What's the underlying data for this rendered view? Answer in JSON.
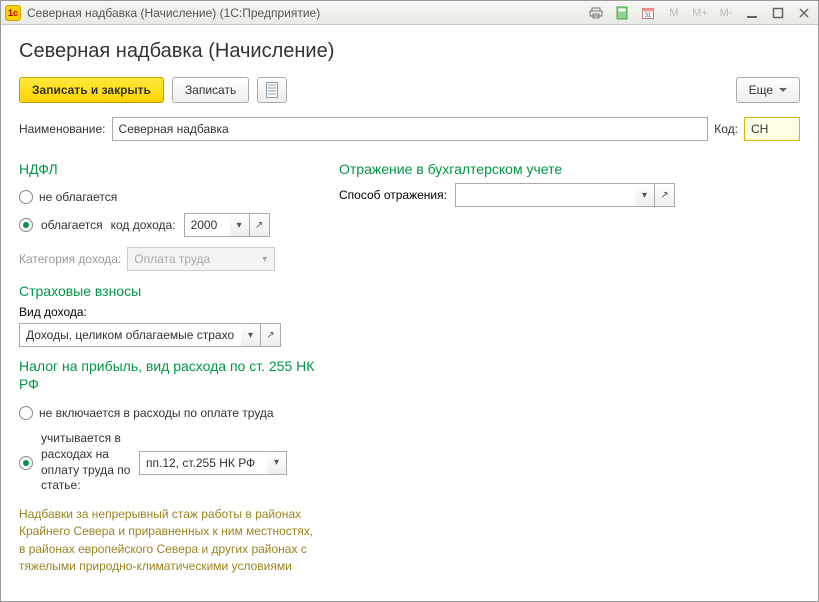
{
  "window": {
    "title": "Северная надбавка (Начисление)  (1С:Предприятие)"
  },
  "titlebar_icons": {
    "m1": "M",
    "m2": "M+",
    "m3": "M-"
  },
  "page": {
    "title": "Северная надбавка (Начисление)"
  },
  "toolbar": {
    "save_close": "Записать и закрыть",
    "save": "Записать",
    "more": "Еще"
  },
  "fields": {
    "name_label": "Наименование:",
    "name_value": "Северная надбавка",
    "code_label": "Код:",
    "code_value": "СН"
  },
  "ndfl": {
    "heading": "НДФЛ",
    "not_taxed": "не облагается",
    "taxed": "облагается",
    "income_code_label": "код дохода:",
    "income_code_value": "2000",
    "category_label": "Категория дохода:",
    "category_value": "Оплата труда"
  },
  "insurance": {
    "heading": "Страховые взносы",
    "kind_label": "Вид дохода:",
    "kind_value": "Доходы, целиком облагаемые страховым"
  },
  "profit_tax": {
    "heading": "Налог на прибыль, вид расхода по ст. 255 НК РФ",
    "not_included": "не включается в расходы по оплате труда",
    "included_text": "учитывается в расходах на оплату труда по статье:",
    "article_value": "пп.12, ст.255 НК РФ"
  },
  "note": "Надбавки за непрерывный стаж работы в районах Крайнего Севера и приравненных к ним местностях, в районах европейского Севера и других районах с тяжелыми природно-климатическими условиями",
  "accounting": {
    "heading": "Отражение в бухгалтерском учете",
    "method_label": "Способ отражения:",
    "method_value": ""
  }
}
